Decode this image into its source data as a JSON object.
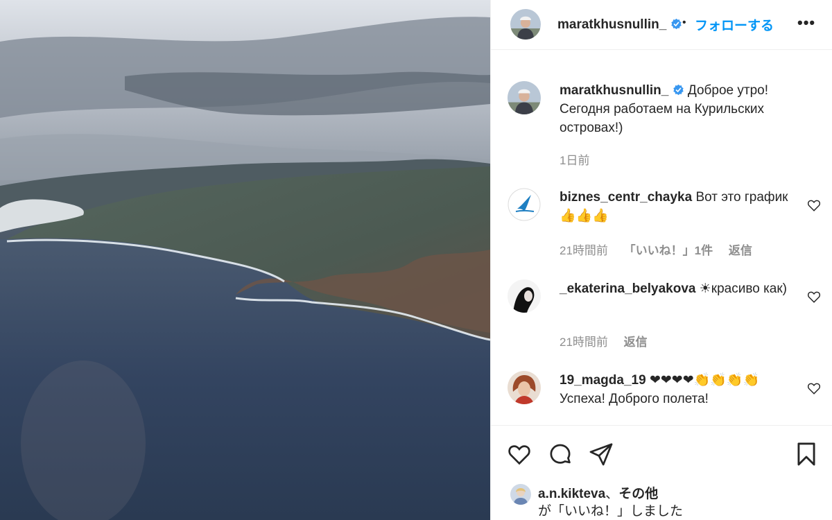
{
  "post": {
    "username": "maratkhusnullin_",
    "follow_separator": "•",
    "follow_label": "フォローする",
    "more_label": "•••"
  },
  "caption": {
    "username": "maratkhusnullin_",
    "text": "Доброе утро! Сегодня работаем на Курильских островах!)",
    "timestamp": "1日前"
  },
  "comments": [
    {
      "username": "biznes_centr_chayka",
      "text": "Вот это график 👍👍👍",
      "time": "21時間前",
      "likes": "「いいね！」1件",
      "reply": "返信"
    },
    {
      "username": "_ekaterina_belyakova",
      "text": "☀красиво как)",
      "time": "21時間前",
      "likes": "",
      "reply": "返信"
    },
    {
      "username": "19_magda_19",
      "text": "❤❤❤❤👏👏👏👏 Успеха! Доброго полета!",
      "time": "",
      "likes": "",
      "reply": ""
    }
  ],
  "liked_by": {
    "user": "a.n.kikteva",
    "separator": "、",
    "others": "その他",
    "suffix": "が「いいね！」しました"
  },
  "colors": {
    "accent": "#0095f6",
    "verified": "#3897f0",
    "text": "#262626",
    "muted": "#8e8e8e"
  },
  "icons": [
    "verified-badge-icon",
    "heart-icon",
    "comment-icon",
    "share-icon",
    "bookmark-icon",
    "more-icon"
  ]
}
